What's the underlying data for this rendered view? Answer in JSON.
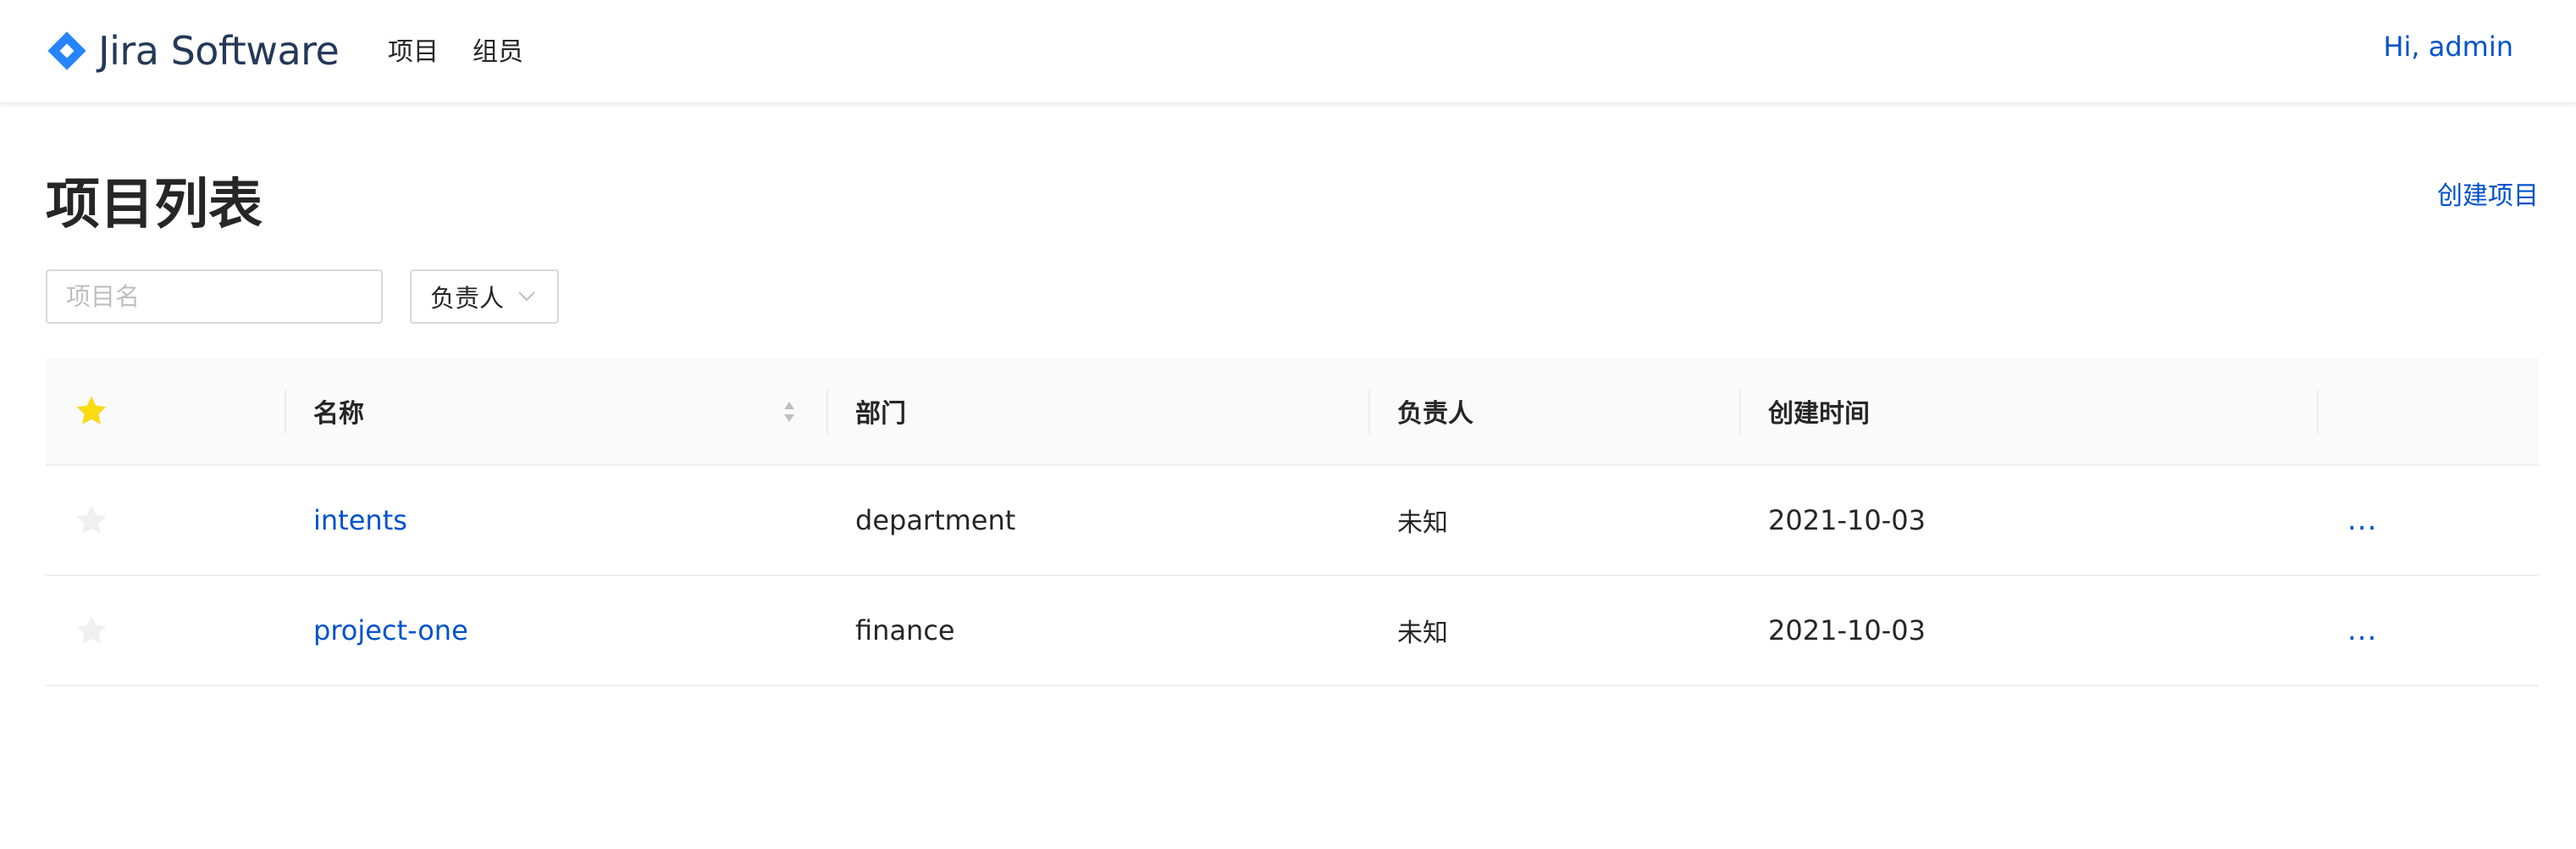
{
  "header": {
    "brand": "Jira Software",
    "nav": [
      {
        "label": "项目"
      },
      {
        "label": "组员"
      }
    ],
    "greeting": "Hi, admin"
  },
  "page": {
    "title": "项目列表",
    "create_label": "创建项目"
  },
  "filters": {
    "name_placeholder": "项目名",
    "owner_label": "负责人"
  },
  "table": {
    "columns": [
      "",
      "名称",
      "部门",
      "负责人",
      "创建时间",
      ""
    ],
    "rows": [
      {
        "starred": false,
        "name": "intents",
        "department": "department",
        "owner": "未知",
        "created": "2021-10-03",
        "actions": "..."
      },
      {
        "starred": false,
        "name": "project-one",
        "department": "finance",
        "owner": "未知",
        "created": "2021-10-03",
        "actions": "..."
      }
    ]
  },
  "colors": {
    "accent": "#0052cc",
    "logo": "#2684ff",
    "star_active": "#fadb14",
    "star_inactive": "#f0f0f0",
    "header_bg": "#fafafa"
  }
}
